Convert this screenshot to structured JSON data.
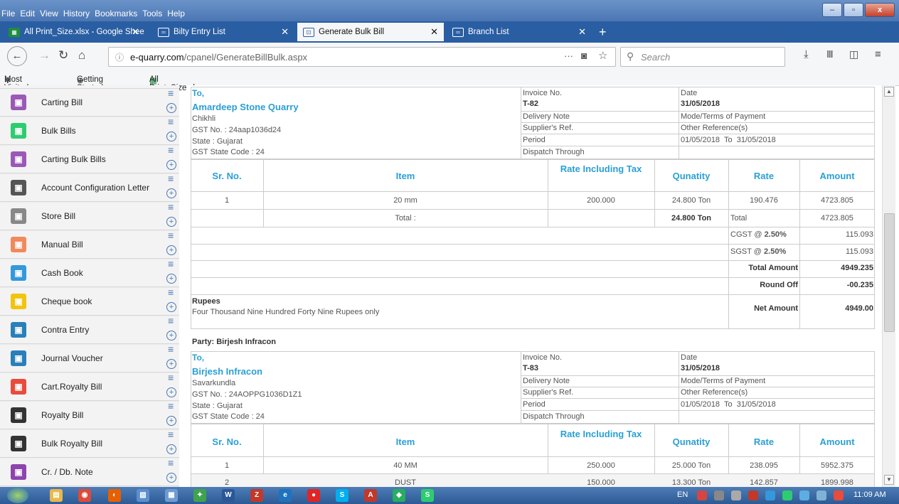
{
  "menu": [
    "File",
    "Edit",
    "View",
    "History",
    "Bookmarks",
    "Tools",
    "Help"
  ],
  "tabs": [
    {
      "label": "All Print_Size.xlsx - Google Shee",
      "active": false
    },
    {
      "label": "Bilty Entry List",
      "active": false
    },
    {
      "label": "Generate Bulk Bill",
      "active": true
    },
    {
      "label": "Branch List",
      "active": false
    }
  ],
  "url": {
    "domain": "e-quarry.com",
    "path": "/cpanel/GenerateBillBulk.aspx"
  },
  "search_placeholder": "Search",
  "bookmarks": [
    "Most Visited",
    "Getting Started",
    "All Print_Size.xlsx - Go..."
  ],
  "sidebar": [
    {
      "label": "Carting Bill",
      "color": "#9b59b6",
      "icon": "truck-icon"
    },
    {
      "label": "Bulk Bills",
      "color": "#2ecc71",
      "icon": "bills-icon"
    },
    {
      "label": "Carting Bulk Bills",
      "color": "#9b59b6",
      "icon": "truck-icon"
    },
    {
      "label": "Account Configuration Letter",
      "color": "#555555",
      "icon": "person-icon"
    },
    {
      "label": "Store Bill",
      "color": "#888888",
      "icon": "store-icon"
    },
    {
      "label": "Manual Bill",
      "color": "#f08a5d",
      "icon": "manual-icon"
    },
    {
      "label": "Cash Book",
      "color": "#3498db",
      "icon": "cash-book-icon"
    },
    {
      "label": "Cheque book",
      "color": "#f1c40f",
      "icon": "cheque-icon"
    },
    {
      "label": "Contra Entry",
      "color": "#2980b9",
      "icon": "contra-icon"
    },
    {
      "label": "Journal Voucher",
      "color": "#2980b9",
      "icon": "journal-icon"
    },
    {
      "label": "Cart.Royalty Bill",
      "color": "#e74c3c",
      "icon": "royalty-icon"
    },
    {
      "label": "Royalty Bill",
      "color": "#333333",
      "icon": "royalty-icon"
    },
    {
      "label": "Bulk Royalty Bill",
      "color": "#333333",
      "icon": "royalty-icon"
    },
    {
      "label": "Cr. / Db. Note",
      "color": "#8e44ad",
      "icon": "note-icon"
    }
  ],
  "bill1": {
    "to": "To,",
    "name": "Amardeep Stone Quarry",
    "city": "Chikhli",
    "gst": "GST No. : 24aap1036d24",
    "state": "State : Gujarat",
    "state_code": "GST State Code : 24",
    "invoice_label": "Invoice No.",
    "invoice": "T-82",
    "date_label": "Date",
    "date": "31/05/2018",
    "delivery": "Delivery Note",
    "mode": "Mode/Terms of Payment",
    "supplier": "Supplier's Ref.",
    "other": "Other Reference(s)",
    "period_label": "Period",
    "period": "01/05/2018  To  31/05/2018",
    "dispatch": "Dispatch Through",
    "cols": [
      "Sr. No.",
      "Item",
      "Rate Including Tax",
      "Qunatity",
      "Rate",
      "Amount"
    ],
    "row": {
      "sr": "1",
      "item": "20 mm",
      "rate_tax": "200.000",
      "qty": "24.800 Ton",
      "rate": "190.476",
      "amount": "4723.805"
    },
    "total_label": "Total :",
    "total_qty": "24.800 Ton",
    "total_word": "Total",
    "total_amount": "4723.805",
    "cgst_label": "CGST @ ",
    "cgst_rate": "2.50%",
    "cgst": "115.093",
    "sgst_label": "SGST @ ",
    "sgst_rate": "2.50%",
    "sgst": "115.093",
    "total_amount_label": "Total Amount",
    "grand": "4949.235",
    "round_label": "Round Off",
    "round": "-00.235",
    "rupees_label": "Rupees",
    "rupees_words": "Four Thousand Nine Hundred Forty Nine Rupees only",
    "net_label": "Net Amount",
    "net": "4949.00"
  },
  "party2_label": "Party: Birjesh Infracon",
  "bill2": {
    "to": "To,",
    "name": "Birjesh Infracon",
    "city": "Savarkundla",
    "gst": "GST No. : 24AOPPG1036D1Z1",
    "state": "State : Gujarat",
    "state_code": "GST State Code : 24",
    "invoice_label": "Invoice No.",
    "invoice": "T-83",
    "date_label": "Date",
    "date": "31/05/2018",
    "delivery": "Delivery Note",
    "mode": "Mode/Terms of Payment",
    "supplier": "Supplier's Ref.",
    "other": "Other Reference(s)",
    "period_label": "Period",
    "period": "01/05/2018  To  31/05/2018",
    "dispatch": "Dispatch Through",
    "cols": [
      "Sr. No.",
      "Item",
      "Rate Including Tax",
      "Qunatity",
      "Rate",
      "Amount"
    ],
    "rows": [
      {
        "sr": "1",
        "item": "40 MM",
        "rate_tax": "250.000",
        "qty": "25.000 Ton",
        "rate": "238.095",
        "amount": "5952.375"
      },
      {
        "sr": "2",
        "item": "DUST",
        "rate_tax": "150.000",
        "qty": "13.300 Ton",
        "rate": "142.857",
        "amount": "1899.998"
      }
    ]
  },
  "taskbar": {
    "lang": "EN",
    "time": "11:09 AM"
  }
}
